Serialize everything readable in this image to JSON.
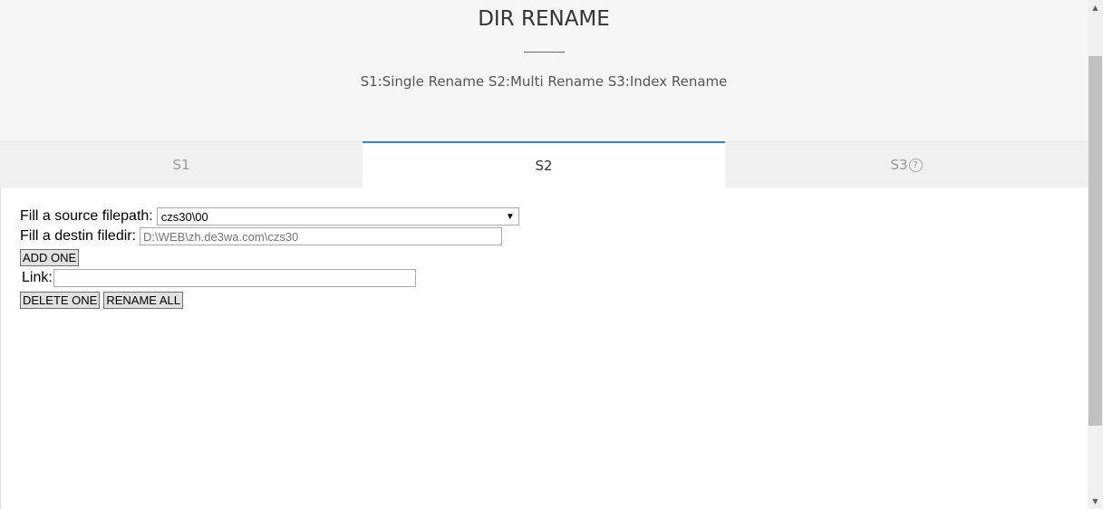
{
  "header": {
    "title": "DIR RENAME",
    "subtitle": "S1:Single Rename S2:Multi Rename S3:Index Rename"
  },
  "tabs": [
    {
      "label": "S1"
    },
    {
      "label": "S2",
      "active": true
    },
    {
      "label": "S3",
      "icon": "help-icon",
      "icon_text": "?"
    }
  ],
  "form": {
    "source_label": "Fill a source filepath:",
    "source_value": "czs30\\00",
    "destin_label": "Fill a destin filedir:",
    "destin_placeholder": "D:\\WEB\\zh.de3wa.com\\czs30",
    "add_one": "ADD ONE",
    "link_label": "Link:",
    "link_value": "",
    "delete_one": "DELETE ONE",
    "rename_all": "RENAME ALL"
  },
  "colors": {
    "accent": "#1e88e5",
    "header_bg": "#f6f6f6",
    "tab_bg": "#f0f0f0"
  }
}
